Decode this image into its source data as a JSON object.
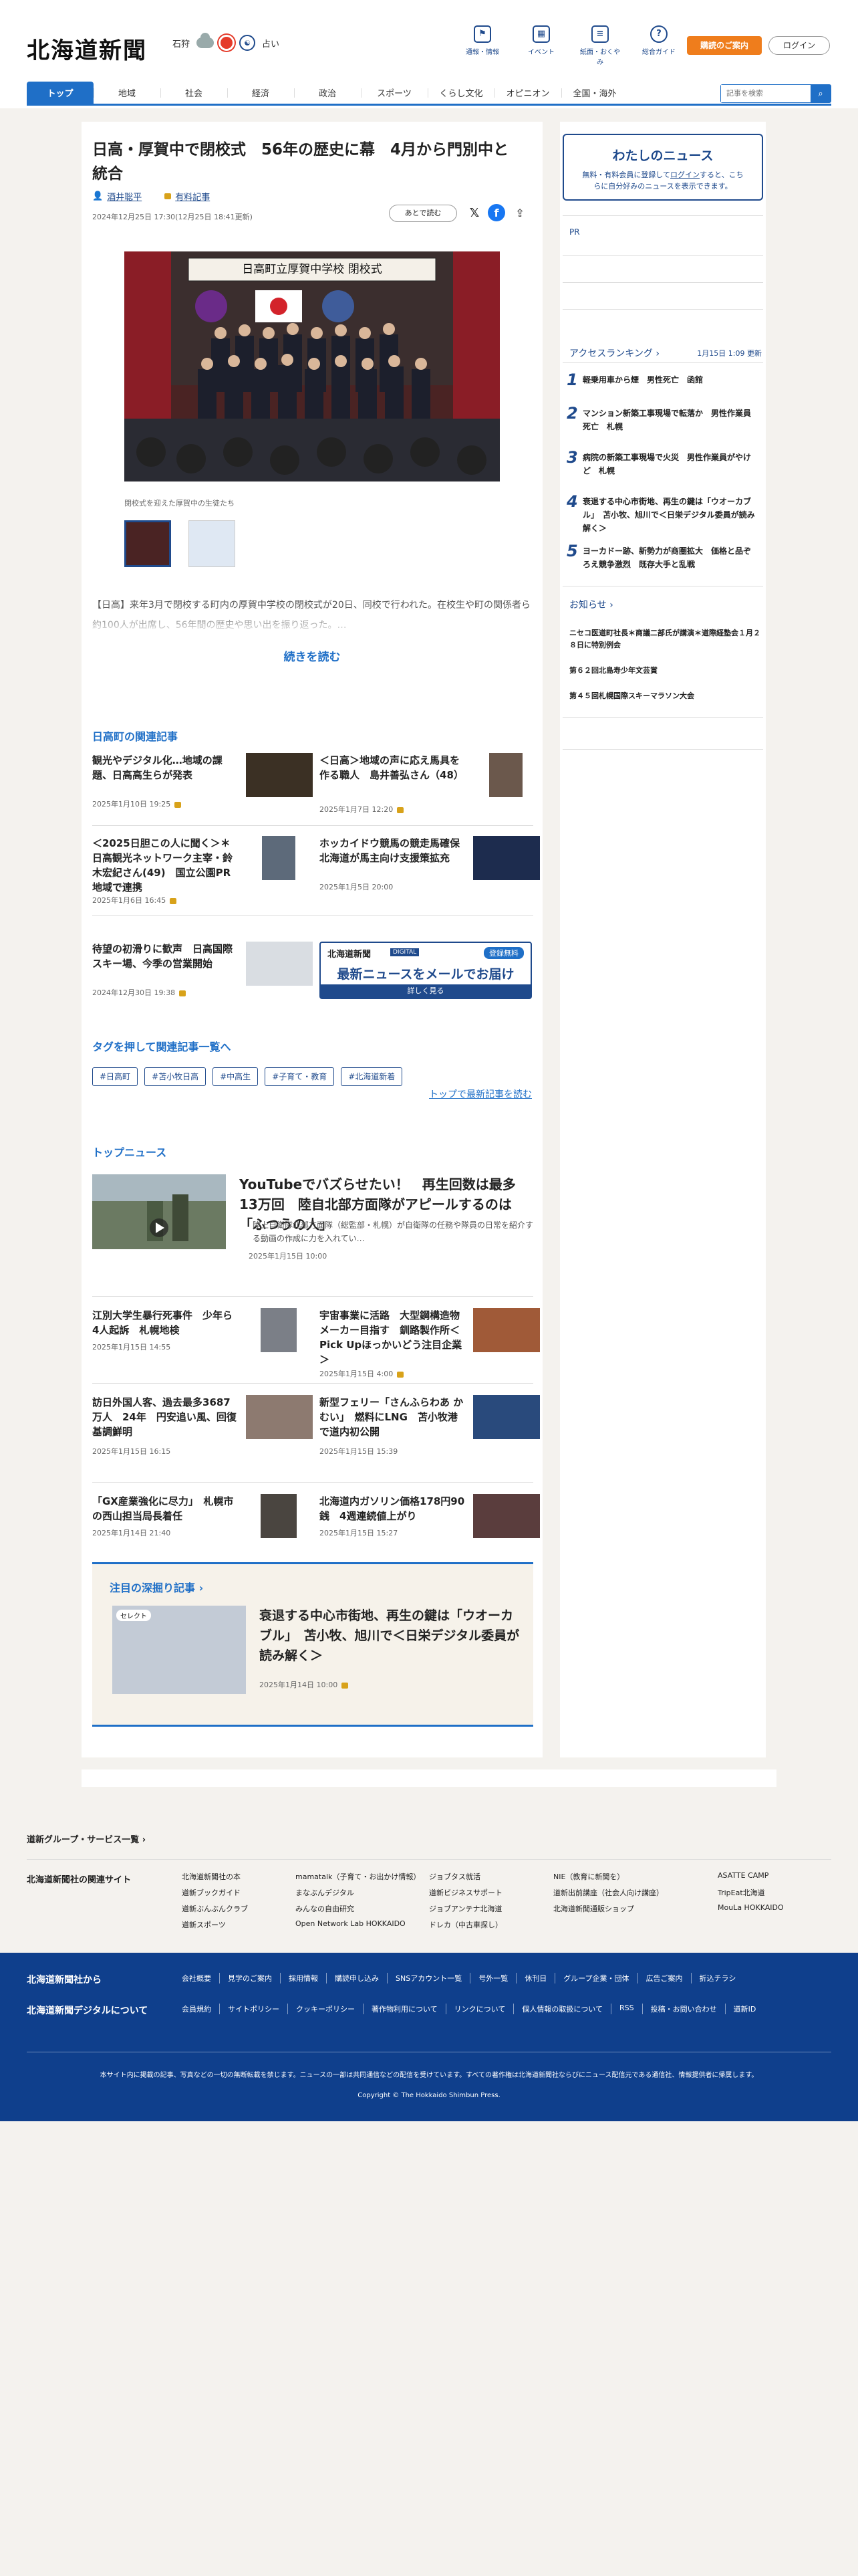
{
  "header": {
    "logo": "北海道新聞",
    "weather_area": "石狩",
    "weather_luck": "占い",
    "tools": [
      {
        "icon": "flag",
        "label": "通報・情報"
      },
      {
        "icon": "calendar",
        "label": "イベント"
      },
      {
        "icon": "newspaper",
        "label": "紙面・おくやみ"
      },
      {
        "icon": "question",
        "label": "総合ガイド"
      }
    ],
    "subscribe": "購読のご案内",
    "login": "ログイン"
  },
  "nav": {
    "items": [
      "トップ",
      "地域",
      "社会",
      "経済",
      "政治",
      "スポーツ",
      "くらし文化",
      "オピニオン",
      "全国・海外"
    ],
    "search_placeholder": "記事を検索"
  },
  "article": {
    "title": "日高・厚賀中で閉校式　56年の歴史に幕　4月から門別中と統合",
    "author": "酒井聡平",
    "premium": "有料記事",
    "datetime": "2024年12月25日 17:30(12月25日 18:41更新)",
    "later": "あとで読む",
    "sign_text": "日高町立厚賀中学校 閉校式",
    "caption": "閉校式を迎えた厚賀中の生徒たち",
    "lead": "【日高】来年3月で閉校する町内の厚賀中学校の閉校式が20日、同校で行われた。在校生や町の関係者ら約100人が出席し、56年間の歴史や思い出を振り返った。…",
    "more": "続きを読む"
  },
  "related": {
    "heading": "日高町の関連記事",
    "items": [
      {
        "title": "観光やデジタル化…地域の課題、日高高生らが発表",
        "date": "2025年1月10日 19:25"
      },
      {
        "title": "＜日高＞地域の声に応え馬具を作る職人　島井善弘さん（48）",
        "date": "2025年1月7日 12:20"
      },
      {
        "title": "＜2025日胆この人に聞く＞＊日高観光ネットワーク主宰・鈴木宏紀さん(49)　国立公園PR　地域で連携",
        "date": "2025年1月6日 16:45"
      },
      {
        "title": "ホッカイドウ競馬の競走馬確保　北海道が馬主向け支援策拡充",
        "date": "2025年1月5日 20:00"
      },
      {
        "title": "待望の初滑りに歓声　日高国際スキー場、今季の営業開始",
        "date": "2024年12月30日 19:38"
      }
    ]
  },
  "mail_ad": {
    "brand": "北海道新聞",
    "tag": "DIGITAL",
    "badge": "登録無料",
    "headline": "最新ニュースをメールでお届け",
    "link": "詳しく見る"
  },
  "tags": {
    "heading": "タグを押して関連記事一覧へ",
    "items": [
      "#日高町",
      "#苫小牧日高",
      "#中高生",
      "#子育て・教育",
      "#北海道新着"
    ],
    "newest": "トップで最新記事を読む"
  },
  "top_news": {
    "heading": "トップニュース",
    "main": {
      "title": "YouTubeでバズらせたい！　再生回数は最多13万回　陸自北部方面隊がアピールするのは「ふつうの人」",
      "excerpt": "陸上自衛隊北部方面隊（総監部・札幌）が自衛隊の任務や隊員の日常を紹介する動画の作成に力を入れてい…",
      "date": "2025年1月15日 10:00"
    },
    "items": [
      {
        "title": "江別大学生暴行死事件　少年ら4人起訴　札幌地検",
        "date": "2025年1月15日 14:55"
      },
      {
        "title": "宇宙事業に活路　大型鋼構造物メーカー目指す　釧路製作所＜Pick Upほっかいどう注目企業＞",
        "date": "2025年1月15日 4:00"
      },
      {
        "title": "訪日外国人客、過去最多3687万人　24年　円安追い風、回復基調鮮明",
        "date": "2025年1月15日 16:15"
      },
      {
        "title": "新型フェリー「さんふらわあ かむい」　燃料にLNG　苫小牧港で道内初公開",
        "date": "2025年1月15日 15:39"
      },
      {
        "title": "「GX産業強化に尽力」　札幌市の西山担当局長着任",
        "date": "2025年1月14日 21:40"
      },
      {
        "title": "北海道内ガソリン価格178円90銭　4週連続値上がり",
        "date": "2025年1月15日 15:27"
      }
    ]
  },
  "deep": {
    "heading": "注目の深掘り記事",
    "badge": "セレクト",
    "title": "衰退する中心市街地、再生の鍵は「ウオーカブル」　苫小牧、旭川で＜日栄デジタル委員が読み解く＞",
    "date": "2025年1月14日 10:00"
  },
  "sidebar": {
    "mynews_title": "わたしのニュース",
    "mynews_sub1": "無料・有料会員に登録して",
    "mynews_login": "ログイン",
    "mynews_sub2": "すると、こちらに自分好みのニュースを表示できます。",
    "pr": "PR",
    "ranking_title": "アクセスランキング",
    "ranking_updated": "1月15日 1:09 更新",
    "ranking": [
      {
        "no": "1",
        "title": "軽乗用車から煙　男性死亡　函館"
      },
      {
        "no": "2",
        "title": "マンション新築工事現場で転落か　男性作業員死亡　札幌"
      },
      {
        "no": "3",
        "title": "病院の新築工事現場で火災　男性作業員がやけど　札幌"
      },
      {
        "no": "4",
        "title": "衰退する中心市街地、再生の鍵は「ウオーカブル」　苫小牧、旭川で＜日栄デジタル委員が読み解く＞"
      },
      {
        "no": "5",
        "title": "ヨーカドー跡、新勢力が商圏拡大　価格と品ぞろえ競争激烈　既存大手と乱戦"
      }
    ],
    "notice_title": "お知らせ",
    "notices": [
      "ニセコ医道町社長＊商議二部氏が講演＊道際経塾会１月２８日に特別例会",
      "第６２回北島寿少年文芸賞",
      "第４５回札幌国際スキーマラソン大会"
    ]
  },
  "footer": {
    "group": "道新グループ・サービス一覧",
    "links_title": "北海道新聞社の関連サイト",
    "links": [
      "北海道新聞社の本",
      "mamatalk（子育て・お出かけ情報）",
      "ジョブタス就活",
      "NIE（教育に新聞を）",
      "ASATTE CAMP",
      "道新ブックガイド",
      "まなぶんデジタル",
      "道新ビジネスサポート",
      "道新出前講座（社会人向け講座）",
      "TripEat北海道",
      "道新ぶんぶんクラブ",
      "みんなの自由研究",
      "ジョブアンテナ北海道",
      "北海道新聞通販ショップ",
      "MouLa HOKKAIDO",
      "道新スポーツ",
      "Open Network Lab HOKKAIDO",
      "ドレカ（中古車探し）"
    ],
    "from_company": "北海道新聞社から",
    "about_digital": "北海道新聞デジタルについて",
    "row1": [
      "会社概要",
      "見学のご案内",
      "採用情報",
      "購読申し込み",
      "SNSアカウント一覧",
      "号外一覧",
      "休刊日",
      "グループ企業・団体",
      "広告ご案内",
      "折込チラシ"
    ],
    "row2": [
      "会員規約",
      "サイトポリシー",
      "クッキーポリシー",
      "著作物利用について",
      "リンクについて",
      "個人情報の取扱について",
      "RSS",
      "投稿・お問い合わせ",
      "道新ID"
    ],
    "notice": "本サイト内に掲載の記事、写真などの一切の無断転載を禁じます。ニュースの一部は共同通信などの配信を受けています。すべての著作権は北海道新聞社ならびにニュース配信元である通信社、情報提供者に帰属します。",
    "copyright": "Copyright © The Hokkaido Shimbun Press."
  }
}
